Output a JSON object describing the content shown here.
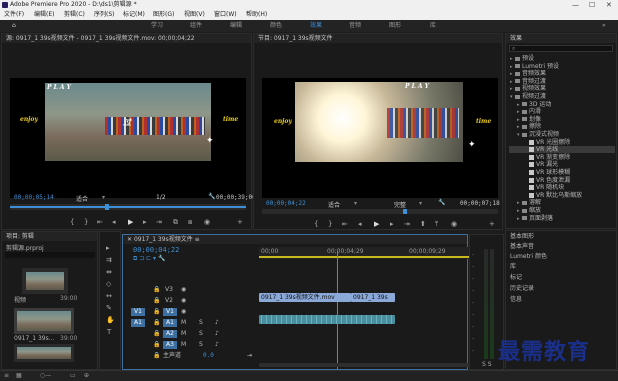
{
  "app": {
    "title": "Adobe Premiere Pro 2020 - D:\\ds1\\剪辑源 *"
  },
  "window_controls": {
    "minimize": "—",
    "maximize": "☐",
    "close": "✕"
  },
  "menu": [
    "文件(F)",
    "编辑(E)",
    "剪辑(C)",
    "序列(S)",
    "标记(M)",
    "图形(G)",
    "视图(V)",
    "窗口(W)",
    "帮助(H)"
  ],
  "workspaces": [
    "学习",
    "组件",
    "编辑",
    "颜色",
    "效果",
    "音频",
    "图形",
    "库"
  ],
  "source": {
    "tab": "源: 0917_1 39s视频文件 - 0917_1 39s视频文件.mov: 00;00;04;22",
    "timecode": "00;00;05;14",
    "fit": "适合",
    "ratio": "1/2",
    "caption_left": "enjoy",
    "caption_right": "time",
    "caption_top": "P L A Y",
    "caption_center": "过"
  },
  "program": {
    "tab": "节目: 0917_1 39s视频文件",
    "timecode": "00;00;04;22",
    "fit": "适合",
    "quality": "完整",
    "duration": "00;00;07;18",
    "caption_left": "enjoy",
    "caption_right": "time",
    "caption_top": "P L A Y"
  },
  "effects": {
    "header": "效果",
    "items": [
      {
        "label": "预设",
        "level": 1,
        "fold": true
      },
      {
        "label": "Lumetri 预设",
        "level": 1,
        "fold": true
      },
      {
        "label": "音频效果",
        "level": 1,
        "fold": true
      },
      {
        "label": "音频过渡",
        "level": 1,
        "fold": true
      },
      {
        "label": "视频效果",
        "level": 1,
        "fold": true
      },
      {
        "label": "视频过渡",
        "level": 1,
        "fold": true,
        "open": true
      },
      {
        "label": "3D 运动",
        "level": 2,
        "fold": true
      },
      {
        "label": "内滑",
        "level": 2,
        "fold": true
      },
      {
        "label": "划像",
        "level": 2,
        "fold": true
      },
      {
        "label": "擦除",
        "level": 2,
        "fold": true
      },
      {
        "label": "沉浸式视频",
        "level": 2,
        "fold": true,
        "open": true
      },
      {
        "label": "VR 光圈擦除",
        "level": 3
      },
      {
        "label": "VR 光线",
        "level": 3,
        "selected": true
      },
      {
        "label": "VR 渐变擦除",
        "level": 3
      },
      {
        "label": "VR 漏光",
        "level": 3
      },
      {
        "label": "VR 球形模糊",
        "level": 3
      },
      {
        "label": "VR 色度泄漏",
        "level": 3
      },
      {
        "label": "VR 随机块",
        "level": 3
      },
      {
        "label": "VR 默比乌斯缩放",
        "level": 3
      },
      {
        "label": "溶解",
        "level": 2,
        "fold": true
      },
      {
        "label": "缩放",
        "level": 2,
        "fold": true
      },
      {
        "label": "页面剥落",
        "level": 2,
        "fold": true
      }
    ]
  },
  "right_panels": [
    "基本图形",
    "基本声音",
    "Lumetri 颜色",
    "库",
    "标记",
    "历史记录",
    "信息"
  ],
  "project": {
    "tab": "项目: 剪辑",
    "file": "剪辑源.prproj",
    "bins": [
      {
        "name": "视频",
        "duration": "39:00"
      },
      {
        "name": "0917_1 39s...",
        "duration": "39:00"
      }
    ]
  },
  "timeline": {
    "tab": "0917_1 39s视频文件",
    "timecode": "00;00;04;22",
    "ruler": [
      "00;00",
      "00;00;04;29",
      "00;00;09;29"
    ],
    "video_tracks": [
      "V3",
      "V2",
      "V1"
    ],
    "audio_tracks": [
      "A1",
      "A2",
      "A3"
    ],
    "master": "主声道",
    "master_value": "0.0",
    "clip_a": "0917_1 39s视频文件.mov",
    "clip_b": "0917_1 39s"
  },
  "watermark": "最需教育",
  "colors": {
    "accent": "#3d8fd6",
    "bg": "#1d1d1d",
    "panel": "#1a1a1a",
    "video_clip": "#8aa8d8",
    "audio_clip": "#4a8fa0",
    "playhead": "#3d8fd6"
  }
}
